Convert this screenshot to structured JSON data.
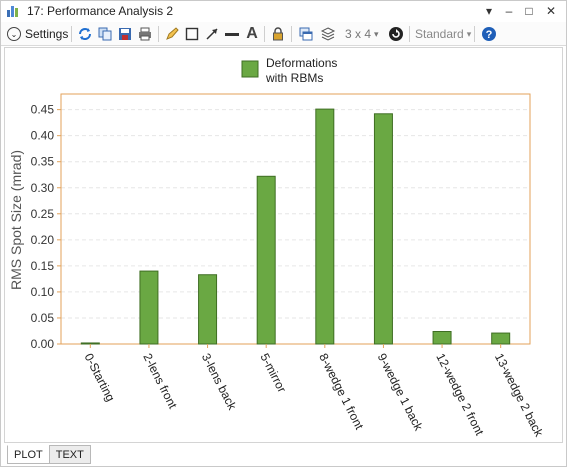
{
  "window": {
    "title": "17: Performance Analysis 2"
  },
  "toolbar": {
    "settings_label": "Settings",
    "layout_label": "3 x 4",
    "style_label": "Standard"
  },
  "tabs": [
    {
      "label": "PLOT",
      "active": true
    },
    {
      "label": "TEXT",
      "active": false
    }
  ],
  "colors": {
    "bar_fill": "#6aa843",
    "bar_stroke": "#3f6e23",
    "axis": "#e3a25a",
    "legend_fill": "#6aa843"
  },
  "chart_data": {
    "type": "bar",
    "ylabel": "RMS Spot Size (mrad)",
    "xlabel": "",
    "ylim": [
      0,
      0.48
    ],
    "yticks": [
      0.0,
      0.05,
      0.1,
      0.15,
      0.2,
      0.25,
      0.3,
      0.35,
      0.4,
      0.45
    ],
    "ytick_labels": [
      "0.00",
      "0.05",
      "0.10",
      "0.15",
      "0.20",
      "0.25",
      "0.30",
      "0.35",
      "0.40",
      "0.45"
    ],
    "categories": [
      "0-Starting",
      "2-lens front",
      "3-lens back",
      "5-mirror",
      "8-wedge 1 front",
      "9-wedge 1 back",
      "12-wedge 2 front",
      "13-wedge 2 back"
    ],
    "series": [
      {
        "name": "Deformations\nwith RBMs",
        "values": [
          0.002,
          0.14,
          0.133,
          0.322,
          0.451,
          0.442,
          0.024,
          0.021
        ]
      }
    ],
    "legend_lines": [
      "Deformations",
      "with RBMs"
    ],
    "legend_position": "top-center",
    "grid": true
  }
}
